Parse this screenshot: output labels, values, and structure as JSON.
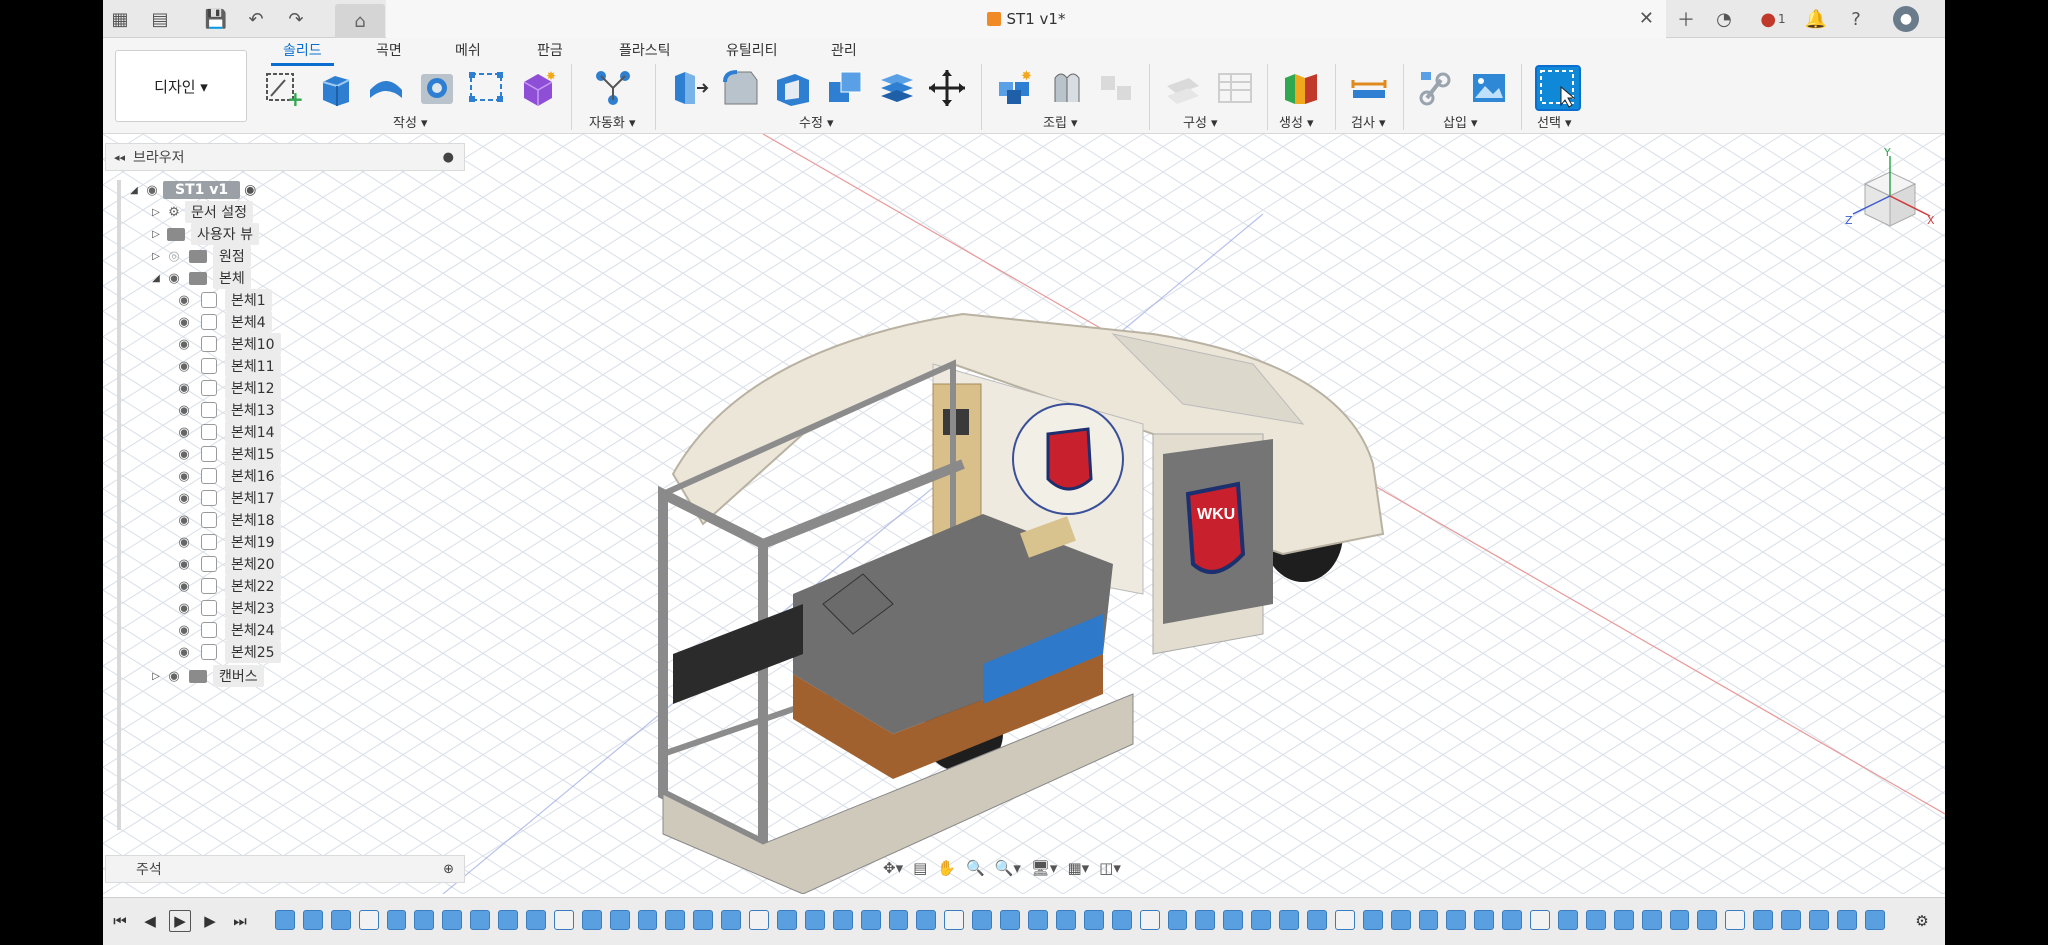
{
  "title_bar": {
    "document_title": "ST1 v1*",
    "notification_count": "1"
  },
  "toolbar": {
    "workspace_label": "디자인 ▾",
    "tabs": [
      "솔리드",
      "곡면",
      "메쉬",
      "판금",
      "플라스틱",
      "유틸리티",
      "관리"
    ],
    "active_tab": "솔리드",
    "groups": {
      "create": "작성 ▾",
      "automate": "자동화 ▾",
      "modify": "수정 ▾",
      "assemble": "조립 ▾",
      "construct": "구성 ▾",
      "generate": "생성 ▾",
      "inspect": "검사 ▾",
      "insert": "삽입 ▾",
      "select": "선택 ▾"
    }
  },
  "browser": {
    "header": "브라우저",
    "root": "ST1 v1",
    "items": {
      "doc_settings": "문서 설정",
      "named_views": "사용자 뷰",
      "origin": "원점",
      "bodies": "본체",
      "canvases": "캔버스"
    },
    "bodies": [
      "본체1",
      "본체4",
      "본체10",
      "본체11",
      "본체12",
      "본체13",
      "본체14",
      "본체15",
      "본체16",
      "본체17",
      "본체18",
      "본체19",
      "본체20",
      "본체22",
      "본체23",
      "본체24",
      "본체25"
    ]
  },
  "comments": {
    "header": "주석"
  },
  "viewcube": {
    "axis_y": "Y",
    "axis_x": "X",
    "axis_z": "Z"
  },
  "model": {
    "logo_text": "WKU"
  },
  "colors": {
    "accent": "#0a6ed1",
    "grid": "#d4dbe6",
    "model_shell": "#ece6d8",
    "model_floor": "#6b6b6b"
  }
}
